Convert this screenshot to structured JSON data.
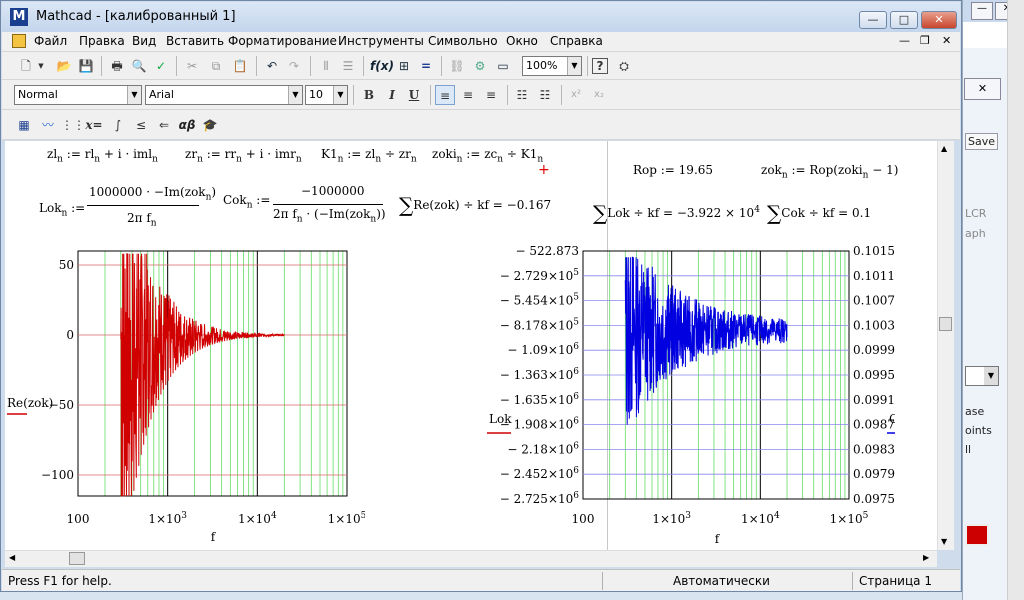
{
  "window": {
    "title": "Mathcad - [калиброванный 1]",
    "min": "—",
    "max": "□",
    "close": "✕"
  },
  "menubar": {
    "items": [
      "Файл",
      "Правка",
      "Вид",
      "Вставить",
      "Форматирование",
      "Инструменты",
      "Символьно",
      "Окно",
      "Справка"
    ]
  },
  "toolbar": {
    "zoom": "100%"
  },
  "format": {
    "style": "Normal",
    "font": "Arial",
    "size": "10",
    "bold": "B",
    "italic": "I",
    "underline": "U"
  },
  "math": {
    "symbolic": "x=",
    "greek": "αβ"
  },
  "worksheet": {
    "eq_zl": "zl",
    "eq_zl_rhs": ":= rl",
    "eq_zl_iml": "+ i · iml",
    "eq_zr": "zr",
    "eq_zr_rhs": ":= rr",
    "eq_zr_imr": "+ i · imr",
    "eq_k1": "K1",
    "eq_k1_rhs": ":= zl",
    "eq_k1_zr": "÷ zr",
    "eq_zoki": "zoki",
    "eq_zoki_rhs": ":= zc",
    "eq_zoki_k1": "÷ K1",
    "n": "n",
    "rop": "Rop := 19.65",
    "zok": "zok",
    "zok_rhs": ":= Rop(zoki",
    "zok_tail": "− 1)",
    "lok": "Lok",
    "lok_num": "1000000 · −Im(zok",
    "lok_den": "2π f",
    "cok": "Cok",
    "cok_num": "−1000000",
    "cok_den": "2π f",
    "cok_den2": "· (−Im(zok",
    "sum1": "Re(zok) ÷ kf = −0.167",
    "sum2": "Lok ÷ kf = −3.922 × 10",
    "sum2_exp": "4",
    "sum3": "Cok ÷ kf = 0.1"
  },
  "chart_data": [
    {
      "type": "line",
      "title": "",
      "xlabel": "f",
      "ylabel": "Re(zok)",
      "xscale": "log",
      "xlim": [
        100,
        100000
      ],
      "ylim": [
        -115,
        60
      ],
      "yticks": [
        "50",
        "0",
        "−50",
        "−100"
      ],
      "xticks": [
        "100",
        "1×10",
        "1×10",
        "1×10"
      ],
      "xticks_exp": [
        "",
        "3",
        "4",
        "5"
      ],
      "series": [
        {
          "name": "Re(zok)",
          "color": "#d00000",
          "description": "damped oscillation around 0 from f≈300 to f≈20000, extremes about +55 and −115"
        }
      ]
    },
    {
      "type": "line",
      "title": "",
      "xlabel": "f",
      "ylabel_left": "Lok",
      "ylabel_right": "Cok",
      "xscale": "log",
      "xlim": [
        100,
        100000
      ],
      "ylim_left": [
        -2725000,
        -522.873
      ],
      "ylim_right": [
        0.0975,
        0.1015
      ],
      "yticks_left": [
        "− 522.873",
        "− 2.729×10",
        "− 5.454×10",
        "− 8.178×10",
        "− 1.09×10",
        "− 1.363×10",
        "− 1.635×10",
        "− 1.908×10",
        "− 2.18×10",
        "− 2.452×10",
        "− 2.725×10"
      ],
      "yticks_left_exp": [
        "",
        "5",
        "5",
        "5",
        "6",
        "6",
        "6",
        "6",
        "6",
        "6",
        "6"
      ],
      "yticks_right": [
        "0.1015",
        "0.1011",
        "0.1007",
        "0.1003",
        "0.0999",
        "0.0995",
        "0.0991",
        "0.0987",
        "0.0983",
        "0.0979",
        "0.0975"
      ],
      "xticks": [
        "100",
        "1×10",
        "1×10",
        "1×10"
      ],
      "xticks_exp": [
        "",
        "3",
        "4",
        "5"
      ],
      "series": [
        {
          "name": "Lok",
          "color": "#d00000",
          "description": "rises steeply from −2.725e6 at f≈300 to near −522.873 by f≈3000"
        },
        {
          "name": "Cok",
          "color": "#0000e0",
          "description": "noisy around 0.1002 from f≈300 to f≈20000"
        }
      ]
    }
  ],
  "status": {
    "help": "Press F1 for help.",
    "mode": "Автоматически",
    "page": "Страница 1"
  },
  "bgwindow": {
    "save": "Save",
    "t1": "LCR",
    "t2": "aph",
    "t3": "ase",
    "t4": "oints",
    "t5": "ll"
  }
}
